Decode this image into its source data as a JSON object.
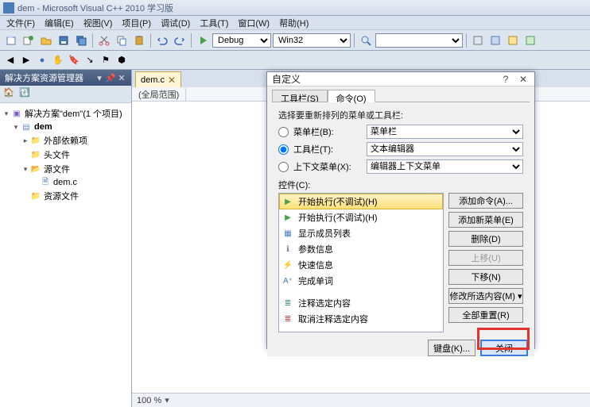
{
  "window": {
    "title": "dem - Microsoft Visual C++ 2010 学习版"
  },
  "menu": {
    "file": "文件(F)",
    "edit": "编辑(E)",
    "view": "视图(V)",
    "project": "项目(P)",
    "debug": "调试(D)",
    "tools": "工具(T)",
    "window": "窗口(W)",
    "help": "帮助(H)"
  },
  "toolbar": {
    "config": "Debug",
    "platform": "Win32"
  },
  "sidebar": {
    "title": "解决方案资源管理器",
    "solution": "解决方案\"dem\"(1 个项目)",
    "project": "dem",
    "external": "外部依赖项",
    "headers": "头文件",
    "sources": "源文件",
    "file": "dem.c",
    "resources": "资源文件"
  },
  "editor": {
    "tab": "dem.c",
    "scope": "(全局范围)"
  },
  "status": {
    "zoom": "100 %"
  },
  "dialog": {
    "title": "自定义",
    "tabs": {
      "toolbar": "工具栏(S)",
      "commands": "命令(O)"
    },
    "rearrange": "选择要重新排列的菜单或工具栏:",
    "menu_radio": "菜单栏(B):",
    "menu_value": "菜单栏",
    "toolbar_radio": "工具栏(T):",
    "toolbar_value": "文本编辑器",
    "context_radio": "上下文菜单(X):",
    "context_value": "编辑器上下文菜单",
    "controls_label": "控件(C):",
    "items": {
      "start_nodebug1": "开始执行(不调试)(H)",
      "start_nodebug2": "开始执行(不调试)(H)",
      "member_list": "显示成员列表",
      "param_info": "参数信息",
      "quick_info": "快速信息",
      "complete_word": "完成单词",
      "comment": "注释选定内容",
      "uncomment": "取消注释选定内容"
    },
    "buttons": {
      "add_command": "添加命令(A)...",
      "add_menu": "添加新菜单(E)",
      "delete": "删除(D)",
      "move_up": "上移(U)",
      "move_down": "下移(N)",
      "modify": "修改所选内容(M) ▾",
      "reset_all": "全部重置(R)",
      "keyboard": "键盘(K)...",
      "close": "关闭"
    }
  }
}
